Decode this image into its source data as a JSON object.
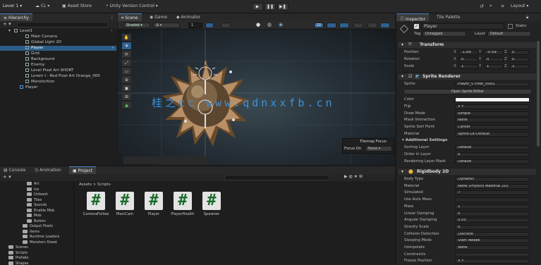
{
  "toolbar": {
    "account": "Lever 1",
    "cloud_label": "CL",
    "asset_store": "Asset Store",
    "version_control": "Unity Version Control",
    "layout": "Layout"
  },
  "hierarchy": {
    "tab": "Hierarchy",
    "items": [
      {
        "label": "Level1",
        "indent": 0
      },
      {
        "label": "Main Camera",
        "indent": 2
      },
      {
        "label": "Global Light 2D",
        "indent": 2
      },
      {
        "label": "Player",
        "indent": 2,
        "selected": true
      },
      {
        "label": "Grid",
        "indent": 2
      },
      {
        "label": "Background",
        "indent": 2
      },
      {
        "label": "Enemy",
        "indent": 2
      },
      {
        "label": "Level Pixel Art SHORT",
        "indent": 2
      },
      {
        "label": "Lorem I - Red Pixel Art Orange_000",
        "indent": 2
      },
      {
        "label": "Monstortion",
        "indent": 2
      },
      {
        "label": "Player",
        "indent": 1
      }
    ]
  },
  "scene": {
    "tabs": [
      "Scene",
      "Game",
      "Animator"
    ],
    "shading": "Shaded",
    "mode_2d": "2D",
    "field_value": "1",
    "overlay_title": "Tilemap Focus",
    "overlay_label": "Focus On",
    "overlay_value": "None",
    "watermark": "桂之cc www.qdnxxfb.cn"
  },
  "bottom": {
    "tabs": [
      "Console",
      "Animation",
      "Project"
    ],
    "breadcrumb": "Assets > Scripts",
    "folders": [
      "Art",
      "Ice",
      "Unleash",
      "Tiles",
      "Sounds",
      "Enable Mob",
      "Mob",
      "Button",
      "Output Pixels",
      "Items",
      "Runtime Loaders",
      "Monsters Sheet"
    ],
    "root_folders": [
      "Scenes",
      "Scripts",
      "Prefabs",
      "Shapes"
    ],
    "assets": [
      "CameraFollow",
      "MainCam",
      "Player",
      "PlayerHealth",
      "Spawner"
    ]
  },
  "inspector": {
    "tabs": [
      "Inspector",
      "Tile Palette"
    ],
    "object_name": "Player",
    "static_label": "Static",
    "tag_label": "Tag",
    "tag_value": "Untagged",
    "layer_label": "Layer",
    "layer_value": "Default",
    "transform": {
      "title": "Transform",
      "rows": [
        {
          "label": "Position",
          "x": "-1.69",
          "y": "-0.09",
          "z": "0"
        },
        {
          "label": "Rotation",
          "x": "0",
          "y": "0",
          "z": "0"
        },
        {
          "label": "Scale",
          "x": "1",
          "y": "1",
          "z": "1"
        }
      ]
    },
    "sprite_renderer": {
      "title": "Sprite Renderer",
      "sprite_label": "Sprite",
      "sprite_value": "Player_0 Pixel_0001",
      "open_editor": "Open Sprite Editor",
      "rows": [
        {
          "label": "Color",
          "value": ""
        },
        {
          "label": "Flip",
          "value": "X  Y"
        },
        {
          "label": "Draw Mode",
          "value": "Simple"
        },
        {
          "label": "Mask Interaction",
          "value": "None"
        },
        {
          "label": "Sprite Sort Point",
          "value": "Center"
        },
        {
          "label": "Material",
          "value": "Sprite-Lit-Default"
        }
      ],
      "additional": "Additional Settings",
      "more_rows": [
        {
          "label": "Sorting Layer",
          "value": "Default"
        },
        {
          "label": "Order in Layer",
          "value": "0"
        },
        {
          "label": "Rendering Layer Mask",
          "value": "Default"
        }
      ]
    },
    "rigidbody": {
      "title": "Rigidbody 2D",
      "rows": [
        {
          "label": "Body Type",
          "value": "Dynamic"
        },
        {
          "label": "Material",
          "value": "None (Physics Material 2D)"
        },
        {
          "label": "Simulated",
          "value": "✓"
        },
        {
          "label": "Use Auto Mass",
          "value": ""
        },
        {
          "label": "Mass",
          "value": "1"
        },
        {
          "label": "Linear Damping",
          "value": "0"
        },
        {
          "label": "Angular Damping",
          "value": "0.05"
        },
        {
          "label": "Gravity Scale",
          "value": "0"
        },
        {
          "label": "Collision Detection",
          "value": "Discrete"
        },
        {
          "label": "Sleeping Mode",
          "value": "Start Awake"
        },
        {
          "label": "Interpolate",
          "value": "None"
        },
        {
          "label": "Constraints",
          "value": ""
        },
        {
          "label": "Freeze Position",
          "value": "X  Y"
        }
      ]
    }
  }
}
